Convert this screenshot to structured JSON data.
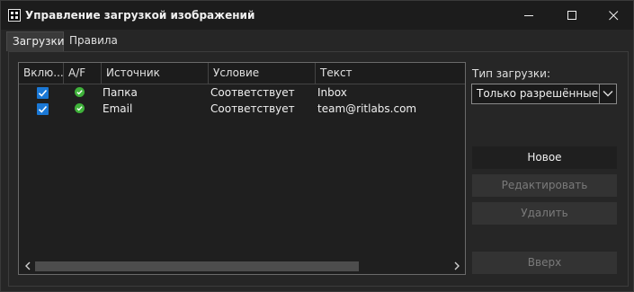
{
  "window": {
    "title": "Управление загрузкой изображений",
    "controls": [
      "minimize-icon",
      "maximize-icon",
      "close-icon"
    ]
  },
  "tabs": [
    {
      "label": "Загрузки",
      "active": true
    },
    {
      "label": "Правила",
      "active": false
    }
  ],
  "table": {
    "columns": [
      "Вклю...",
      "A/F",
      "Источник",
      "Условие",
      "Текст"
    ],
    "rows": [
      {
        "enabled": true,
        "status_icon": "check-circle-icon",
        "source": "Папка",
        "condition": "Соответствует",
        "text": "Inbox"
      },
      {
        "enabled": true,
        "status_icon": "check-circle-icon",
        "source": "Email",
        "condition": "Соответствует",
        "text": "team@ritlabs.com"
      }
    ]
  },
  "side": {
    "load_type_label": "Тип загрузки:",
    "load_type_value": "Только разрешённые",
    "buttons": {
      "new": "Новое",
      "edit": "Редактировать",
      "delete": "Удалить",
      "up": "Вверх"
    }
  },
  "colors": {
    "accent_checkbox": "#1a78d6",
    "status_ok": "#3fb23a",
    "window_bg": "#262626",
    "title_bg": "#1c1c1c"
  }
}
